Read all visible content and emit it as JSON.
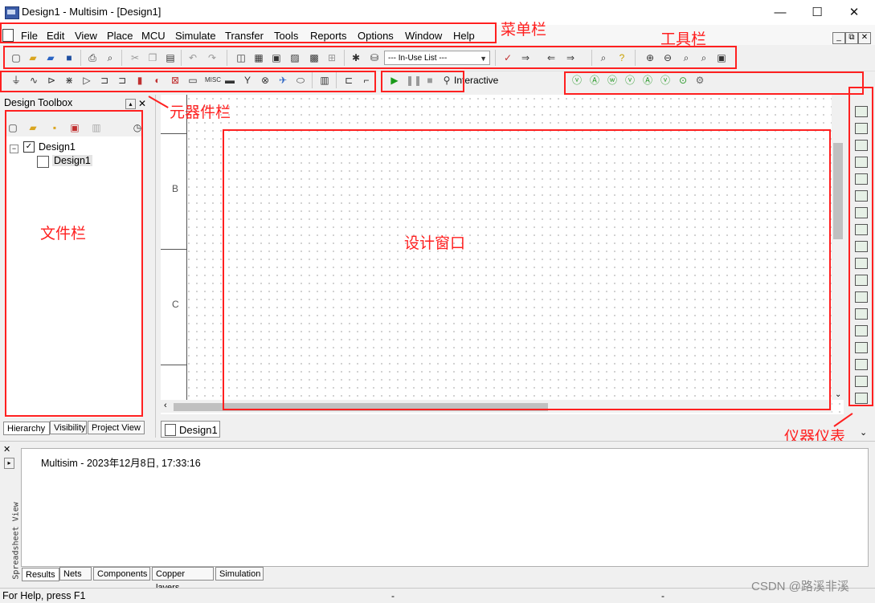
{
  "window": {
    "title": "Design1 - Multisim - [Design1]",
    "controls": [
      "—",
      "☐",
      "✕"
    ]
  },
  "menu": {
    "items": [
      "File",
      "Edit",
      "View",
      "Place",
      "MCU",
      "Simulate",
      "Transfer",
      "Tools",
      "Reports",
      "Options",
      "Window",
      "Help"
    ],
    "mdi_controls": [
      "_",
      "⧉",
      "✕"
    ]
  },
  "toolbar": {
    "in_use_list": "--- In-Use List ---",
    "interactive_label": "Interactive"
  },
  "design_toolbox": {
    "title": "Design Toolbox",
    "tree_root": "Design1",
    "tree_child": "Design1",
    "tabs": [
      "Hierarchy",
      "Visibility",
      "Project View"
    ]
  },
  "canvas": {
    "row_labels": [
      "B",
      "C"
    ],
    "tab_label": "Design1"
  },
  "annotations": {
    "menu_bar": "菜单栏",
    "toolbar": "工具栏",
    "component_bar": "元器件栏",
    "file_bar": "文件栏",
    "design_window": "设计窗口",
    "instruments": "仪器仪表"
  },
  "spreadsheet": {
    "vertical_label": "Spreadsheet View",
    "log_line": "Multisim  -  2023年12月8日, 17:33:16",
    "tabs": [
      "Results",
      "Nets",
      "Components",
      "Copper layers",
      "Simulation"
    ]
  },
  "status": {
    "help_text": "For Help, press F1",
    "separators": [
      "-",
      "-"
    ]
  },
  "watermark": "CSDN @路溪非溪",
  "colors": {
    "annotation": "#ff2020"
  }
}
